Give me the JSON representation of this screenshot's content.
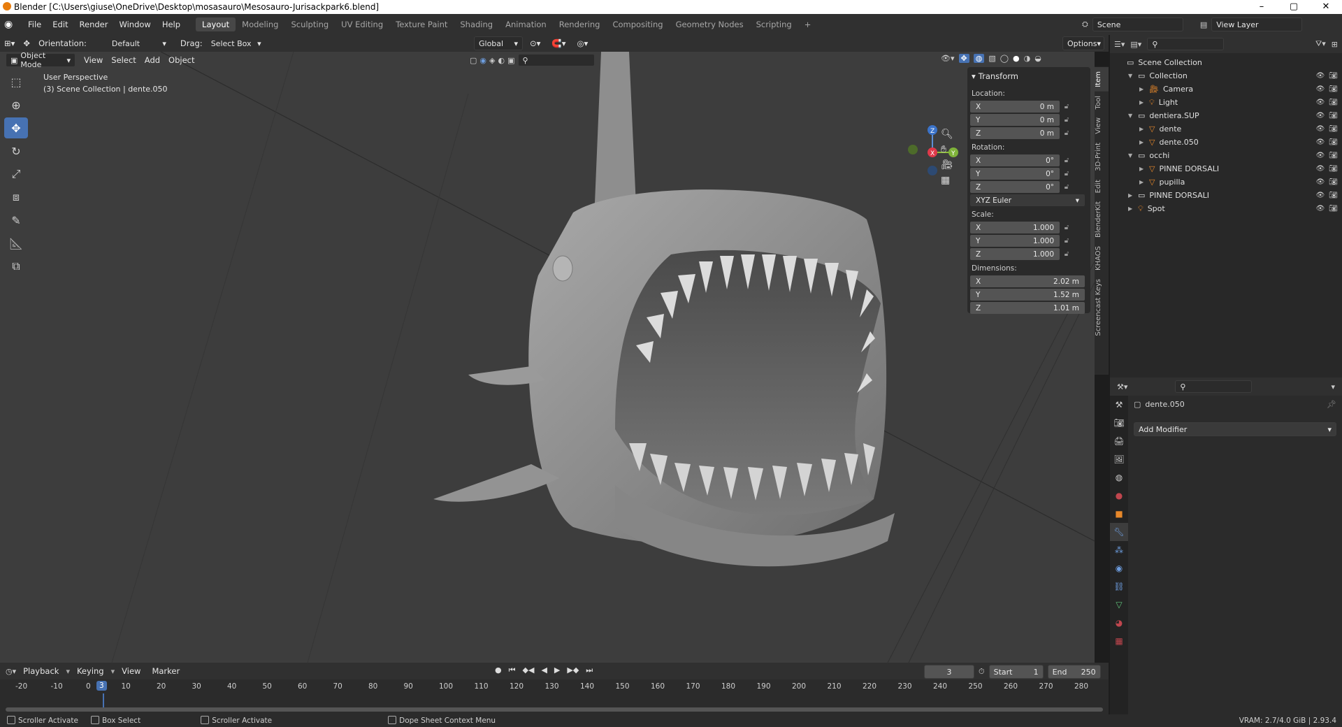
{
  "window": {
    "title": "Blender [C:\\Users\\giuse\\OneDrive\\Desktop\\mosasauro\\Mesosauro-Jurisackpark6.blend]",
    "controls": [
      "–",
      "▢",
      "✕"
    ]
  },
  "menu": {
    "items": [
      "File",
      "Edit",
      "Render",
      "Window",
      "Help"
    ],
    "workspaces": [
      "Layout",
      "Modeling",
      "Sculpting",
      "UV Editing",
      "Texture Paint",
      "Shading",
      "Animation",
      "Rendering",
      "Compositing",
      "Geometry Nodes",
      "Scripting"
    ],
    "active_workspace": "Layout",
    "add_tab": "+",
    "scene_name": "Scene",
    "view_layer": "View Layer"
  },
  "tool_header": {
    "orientation_label": "Orientation:",
    "orientation_value": "Default",
    "drag_label": "Drag:",
    "drag_value": "Select Box",
    "transform_orientation": "Global",
    "options_label": "Options"
  },
  "viewport_header": {
    "mode": "Object Mode",
    "menus": [
      "View",
      "Select",
      "Add",
      "Object"
    ]
  },
  "viewport": {
    "perspective": "User Perspective",
    "context": "(3) Scene Collection | dente.050",
    "gizmo_axes": [
      "X",
      "Y",
      "Z"
    ]
  },
  "n_panel": {
    "title": "Transform",
    "location_label": "Location:",
    "location": [
      {
        "axis": "X",
        "value": "0 m"
      },
      {
        "axis": "Y",
        "value": "0 m"
      },
      {
        "axis": "Z",
        "value": "0 m"
      }
    ],
    "rotation_label": "Rotation:",
    "rotation": [
      {
        "axis": "X",
        "value": "0°"
      },
      {
        "axis": "Y",
        "value": "0°"
      },
      {
        "axis": "Z",
        "value": "0°"
      }
    ],
    "rotation_mode": "XYZ Euler",
    "scale_label": "Scale:",
    "scale": [
      {
        "axis": "X",
        "value": "1.000"
      },
      {
        "axis": "Y",
        "value": "1.000"
      },
      {
        "axis": "Z",
        "value": "1.000"
      }
    ],
    "dimensions_label": "Dimensions:",
    "dimensions": [
      {
        "axis": "X",
        "value": "2.02 m"
      },
      {
        "axis": "Y",
        "value": "1.52 m"
      },
      {
        "axis": "Z",
        "value": "1.01 m"
      }
    ],
    "tabs": [
      "Item",
      "Tool",
      "View",
      "3D-Print",
      "Edit",
      "BlenderKit",
      "KHAOS",
      "Screencast Keys"
    ]
  },
  "outliner": {
    "rows": [
      {
        "label": "Scene Collection",
        "indent": 0,
        "icon": "collection-icon",
        "selected": false
      },
      {
        "label": "Collection",
        "indent": 1,
        "icon": "collection-icon",
        "selected": false
      },
      {
        "label": "Camera",
        "indent": 2,
        "icon": "camera-icon",
        "selected": false
      },
      {
        "label": "Light",
        "indent": 2,
        "icon": "light-icon",
        "selected": false
      },
      {
        "label": "dentiera.SUP",
        "indent": 1,
        "icon": "collection-icon",
        "selected": false
      },
      {
        "label": "dente",
        "indent": 2,
        "icon": "mesh-icon",
        "selected": false
      },
      {
        "label": "dente.050",
        "indent": 2,
        "icon": "mesh-icon",
        "selected": false
      },
      {
        "label": "occhi",
        "indent": 1,
        "icon": "collection-icon",
        "selected": false
      },
      {
        "label": "PINNE DORSALI",
        "indent": 2,
        "icon": "mesh-icon",
        "selected": false
      },
      {
        "label": "pupilla",
        "indent": 2,
        "icon": "mesh-icon",
        "selected": false
      },
      {
        "label": "PINNE DORSALI",
        "indent": 1,
        "icon": "collection-icon",
        "selected": false
      },
      {
        "label": "Spot",
        "indent": 1,
        "icon": "light-icon",
        "selected": false
      }
    ]
  },
  "properties": {
    "object_name": "dente.050",
    "add_modifier": "Add Modifier"
  },
  "timeline": {
    "menus": [
      "Playback",
      "Keying",
      "View",
      "Marker"
    ],
    "current_frame": "3",
    "start_label": "Start",
    "start": "1",
    "end_label": "End",
    "end": "250",
    "ticks": [
      "-20",
      "-10",
      "0",
      "10",
      "20",
      "30",
      "40",
      "50",
      "60",
      "70",
      "80",
      "90",
      "100",
      "110",
      "120",
      "130",
      "140",
      "150",
      "160",
      "170",
      "180",
      "190",
      "200",
      "210",
      "220",
      "230",
      "240",
      "250",
      "260",
      "270",
      "280"
    ],
    "frame_marker": "3"
  },
  "statusbar": {
    "items": [
      "Scroller Activate",
      "Box Select",
      "Scroller Activate",
      "Dope Sheet Context Menu"
    ],
    "vram": "VRAM: 2.7/4.0 GiB | 2.93.4"
  },
  "colors": {
    "accent": "#4772b3",
    "viewport_bg": "#3d3d3d",
    "panel_bg": "#2b2b2b",
    "selection": "#334d80"
  }
}
